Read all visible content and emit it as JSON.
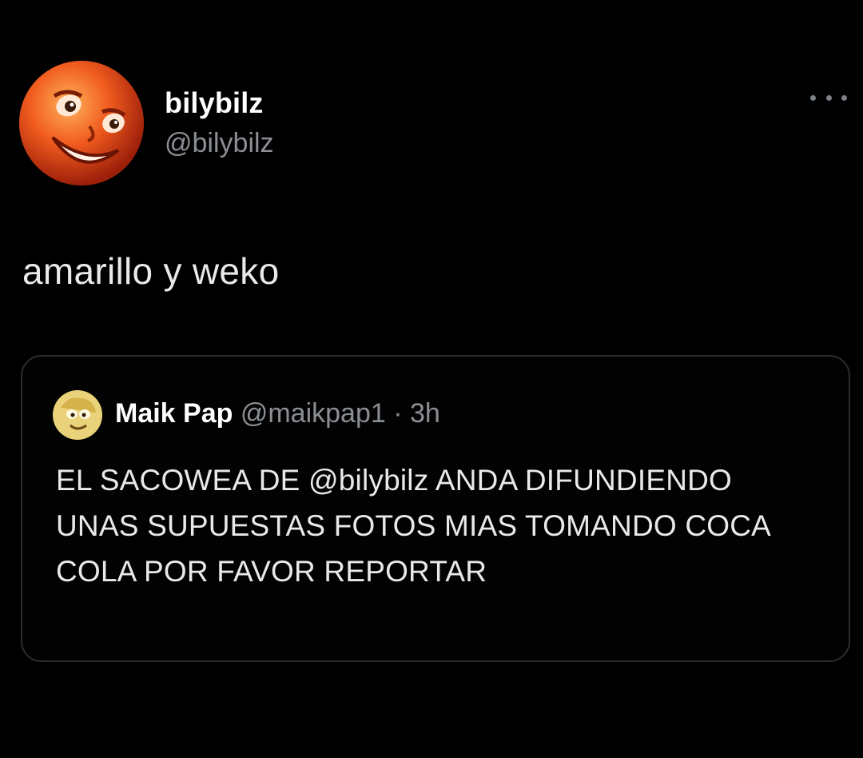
{
  "tweet": {
    "author": {
      "display_name": "bilybilz",
      "handle": "@bilybilz",
      "avatar_icon": "orange-grinning-face-avatar"
    },
    "more_icon": "more-options-icon",
    "text": "amarillo y weko",
    "quoted_tweet": {
      "author": {
        "display_name": "Maik Pap",
        "handle": "@maikpap1",
        "avatar_icon": "yellow-cartoon-avatar"
      },
      "separator": "·",
      "time": "3h",
      "text": "EL SACOWEA DE @bilybilz ANDA DIFUNDIENDO UNAS SUPUESTAS FOTOS MIAS TOMANDO COCA COLA POR FAVOR REPORTAR"
    }
  },
  "colors": {
    "background": "#000000",
    "primary_text": "#e7e9ea",
    "secondary_text": "#8b8f94",
    "card_border": "#2a2d31"
  }
}
